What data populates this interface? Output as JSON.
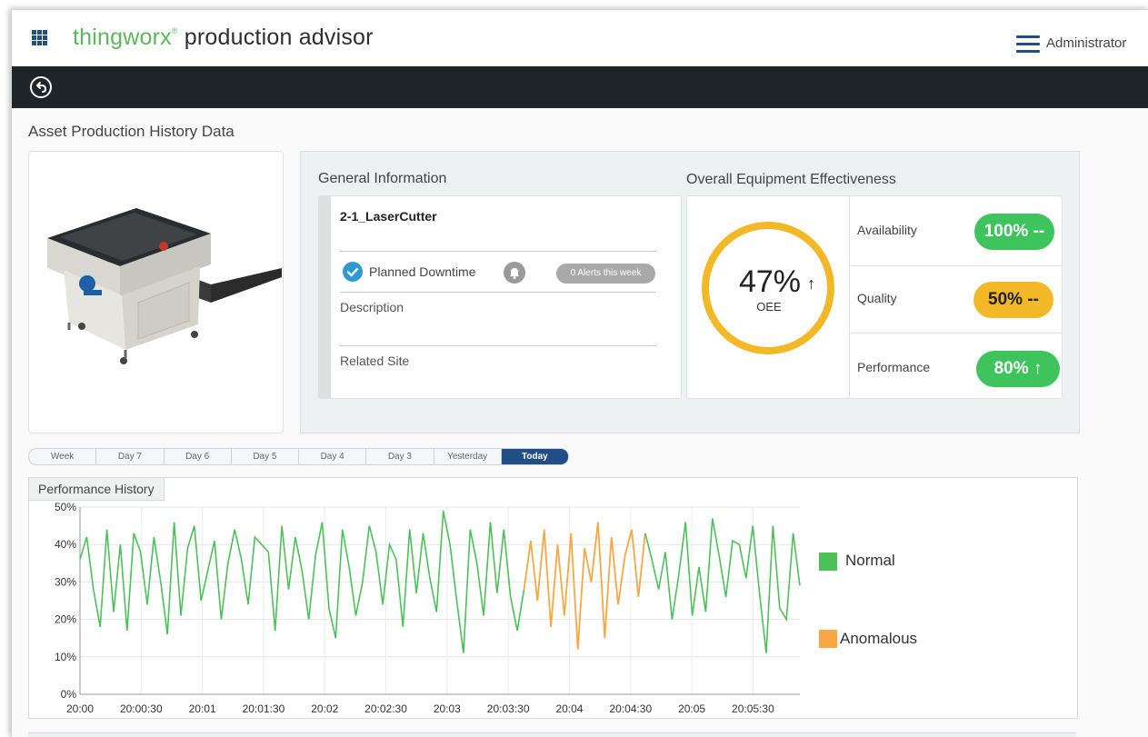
{
  "header": {
    "brand_name": "thingworx",
    "brand_mark": "®",
    "app_name": "production advisor",
    "user": "Administrator"
  },
  "page": {
    "title": "Asset Production History Data"
  },
  "general_info": {
    "title": "General Information",
    "asset_name": "2-1_LaserCutter",
    "status": "Planned Downtime",
    "alerts": "0 Alerts this week",
    "description_label": "Description",
    "related_site_label": "Related Site"
  },
  "oee": {
    "title": "Overall Equipment Effectiveness",
    "value": "47%",
    "arrow": "↑",
    "label": "OEE",
    "metrics": [
      {
        "label": "Availability",
        "value": "100% --",
        "color": "#3fc35c",
        "text_color": "#ffffff"
      },
      {
        "label": "Quality",
        "value": "50% --",
        "color": "#f2b827",
        "text_color": "#222222"
      },
      {
        "label": "Performance",
        "value": "80% ↑",
        "color": "#3fc35c",
        "text_color": "#ffffff"
      }
    ],
    "ring_color": "#f2b827"
  },
  "range_selector": {
    "options": [
      "Week",
      "Day 7",
      "Day 6",
      "Day 5",
      "Day 4",
      "Day 3",
      "Yesterday",
      "Today"
    ],
    "selected": "Today"
  },
  "performance_history": {
    "title": "Performance History",
    "legend": [
      {
        "label": "Normal",
        "color": "#4cc15a"
      },
      {
        "label": "Anomalous",
        "color": "#f7a744"
      }
    ]
  },
  "chart_data": {
    "type": "line",
    "title": "Performance History",
    "xlabel": "",
    "ylabel": "",
    "ylim": [
      0,
      50
    ],
    "y_ticks": [
      "0%",
      "10%",
      "20%",
      "30%",
      "40%",
      "50%"
    ],
    "x_ticks": [
      "20:00",
      "20:00:30",
      "20:01",
      "20:01:30",
      "20:02",
      "20:02:30",
      "20:03",
      "20:03:30",
      "20:04",
      "20:04:30",
      "20:05",
      "20:05:30"
    ],
    "x_range": [
      "20:00:00",
      "20:05:53"
    ],
    "series": [
      {
        "name": "Normal",
        "color": "#4cc15a",
        "approx_values_percent_every_3s": [
          36,
          42,
          28,
          18,
          44,
          22,
          40,
          17,
          43,
          38,
          24,
          42,
          30,
          16,
          46,
          21,
          39,
          45,
          25,
          33,
          41,
          20,
          35,
          44,
          36,
          24,
          42,
          40,
          38,
          17,
          45,
          28,
          42,
          33,
          20,
          37,
          46,
          23,
          15,
          44,
          34,
          21,
          30,
          45,
          38,
          24,
          40,
          36,
          18,
          44,
          27,
          43,
          31,
          22,
          49,
          40,
          25,
          11,
          44,
          35,
          21,
          46,
          27,
          44,
          26,
          17,
          43,
          36,
          28,
          38,
          20,
          32,
          46,
          21,
          34,
          22,
          47,
          37,
          26,
          41,
          40,
          31,
          45,
          27,
          11,
          45,
          23,
          20,
          43,
          29
        ]
      },
      {
        "name": "Anomalous",
        "color": "#f7a744",
        "approx_values_percent_every_3s": [
          28,
          41,
          25,
          44,
          18,
          40,
          21,
          43,
          12,
          39,
          30,
          46,
          15,
          42,
          24,
          37,
          44,
          26
        ]
      }
    ]
  }
}
